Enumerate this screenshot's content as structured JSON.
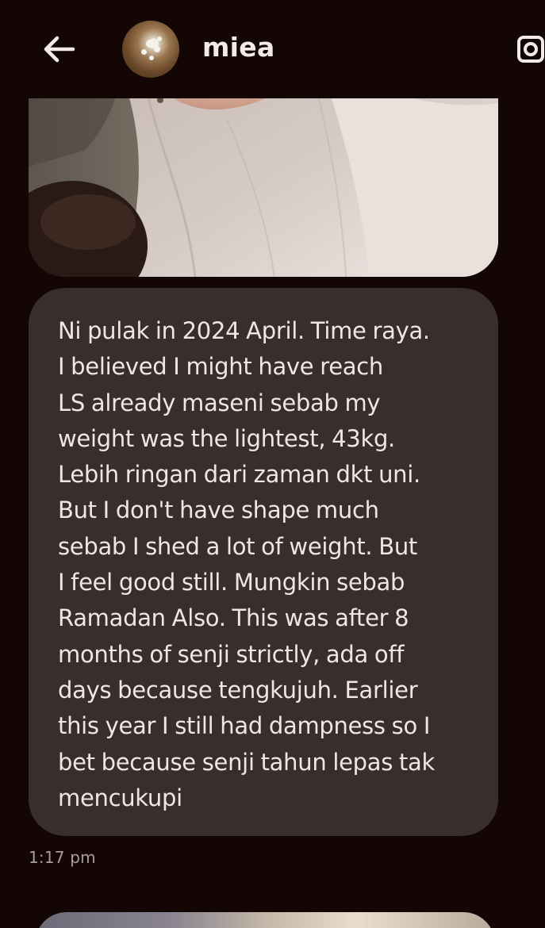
{
  "header": {
    "back_icon": "arrow-left-icon",
    "username": "miea",
    "action_icon": "camera-icon"
  },
  "messages": [
    {
      "type": "image"
    },
    {
      "type": "text",
      "lines": [
        "Ni pulak in 2024 April. Time raya.",
        "I believed I might have reach",
        "LS already maseni sebab my",
        "weight was the lightest, 43kg.",
        "Lebih ringan dari zaman dkt uni.",
        "But I don't have shape much",
        "sebab I shed a lot of weight. But",
        "I feel good still. Mungkin sebab",
        "Ramadan Also. This was after 8",
        "months of senji strictly, ada off",
        "days because tengkujuh. Earlier",
        "this year I still had dampness so I",
        "bet because senji tahun lepas tak",
        "mencukupi"
      ],
      "timestamp": "1:17 pm"
    },
    {
      "type": "image"
    }
  ],
  "colors": {
    "background": "#130605",
    "bubble": "#382e2c",
    "text": "#eee7e2",
    "timestamp": "#a89e9a"
  }
}
